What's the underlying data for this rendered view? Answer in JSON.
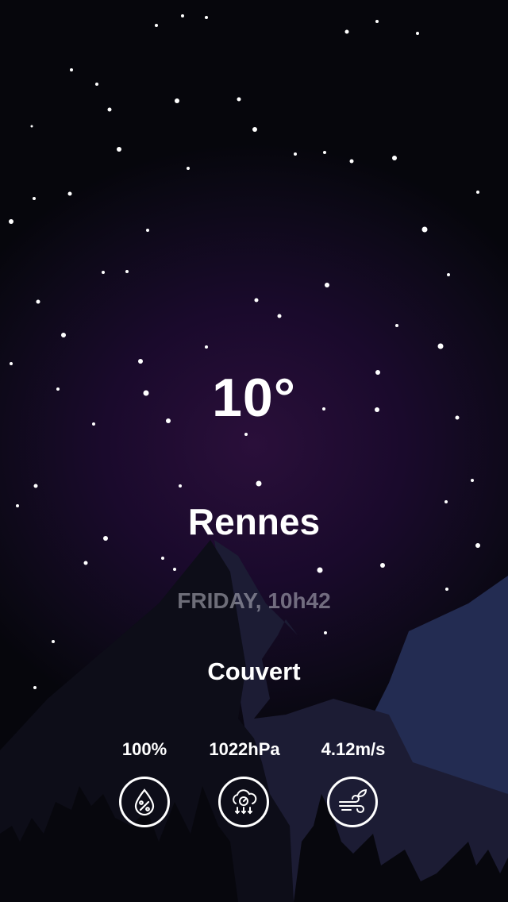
{
  "weather": {
    "temperature": "10°",
    "city": "Rennes",
    "datetime": "FRIDAY, 10h42",
    "condition": "Couvert"
  },
  "metrics": [
    {
      "value": "100%",
      "icon": "humidity-drop-icon"
    },
    {
      "value": "1022hPa",
      "icon": "pressure-cloud-icon"
    },
    {
      "value": "4.12m/s",
      "icon": "wind-leaf-icon"
    }
  ],
  "colors": {
    "sky_top": "#06060c",
    "sky_glow": "#2a0f3a",
    "mountain_far": "#232c52",
    "mountain_mid": "#1a1a30",
    "mountain_near": "#0c0c16",
    "text": "#ffffff"
  }
}
